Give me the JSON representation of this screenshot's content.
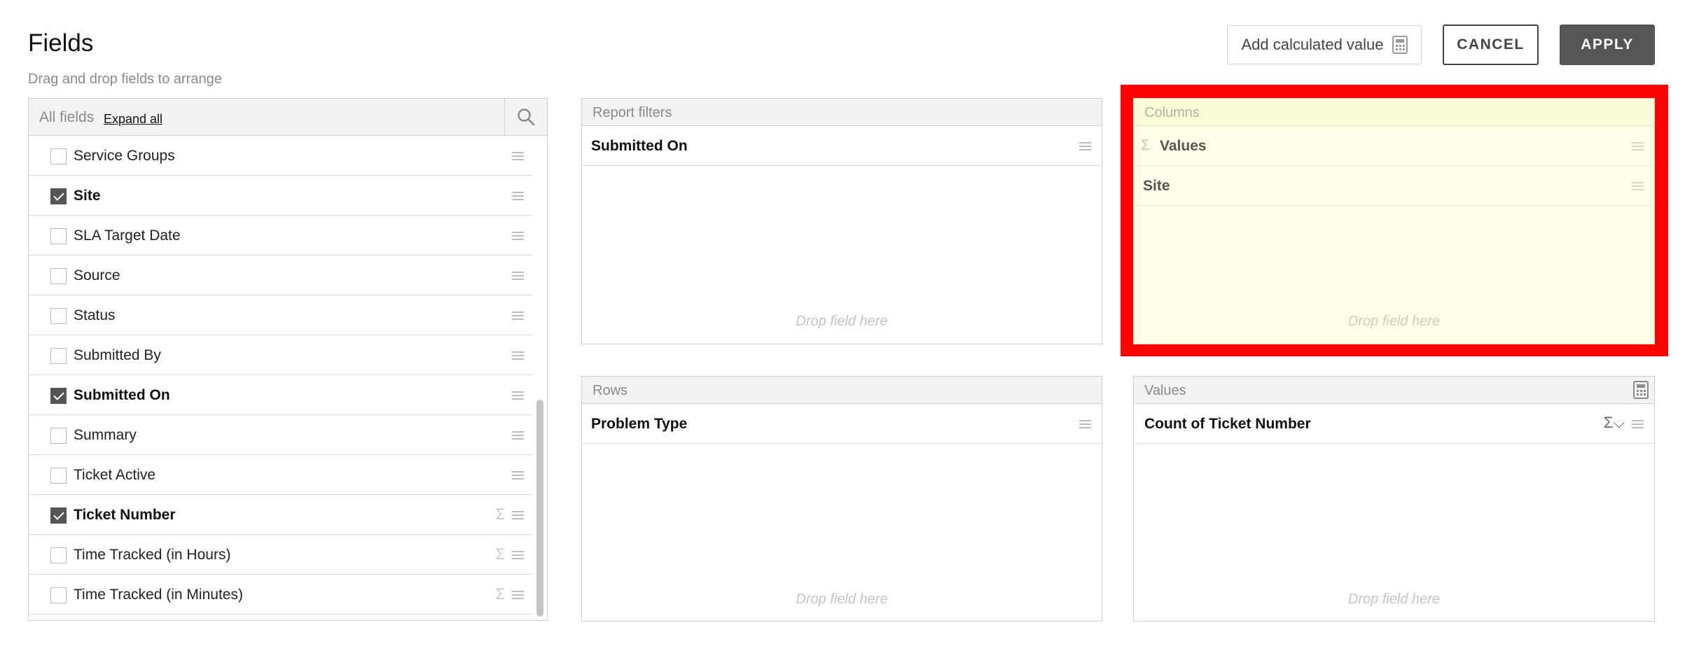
{
  "header": {
    "title": "Fields",
    "subtitle": "Drag and drop fields to arrange",
    "add_calculated_label": "Add calculated value",
    "cancel_label": "CANCEL",
    "apply_label": "APPLY"
  },
  "fields_panel": {
    "header_label": "All fields",
    "expand_all_label": "Expand all",
    "items": [
      {
        "label": "Service Groups",
        "checked": false,
        "numeric": false
      },
      {
        "label": "Site",
        "checked": true,
        "numeric": false
      },
      {
        "label": "SLA Target Date",
        "checked": false,
        "numeric": false
      },
      {
        "label": "Source",
        "checked": false,
        "numeric": false
      },
      {
        "label": "Status",
        "checked": false,
        "numeric": false
      },
      {
        "label": "Submitted By",
        "checked": false,
        "numeric": false
      },
      {
        "label": "Submitted On",
        "checked": true,
        "numeric": false
      },
      {
        "label": "Summary",
        "checked": false,
        "numeric": false
      },
      {
        "label": "Ticket Active",
        "checked": false,
        "numeric": false
      },
      {
        "label": "Ticket Number",
        "checked": true,
        "numeric": true
      },
      {
        "label": "Time Tracked (in Hours)",
        "checked": false,
        "numeric": true
      },
      {
        "label": "Time Tracked (in Minutes)",
        "checked": false,
        "numeric": true
      }
    ]
  },
  "zones": {
    "report_filters": {
      "title": "Report filters",
      "items": [
        "Submitted On"
      ],
      "drop_hint": "Drop field here"
    },
    "columns": {
      "title": "Columns",
      "items": [
        "Values",
        "Site"
      ],
      "drop_hint": "Drop field here"
    },
    "rows": {
      "title": "Rows",
      "items": [
        "Problem Type"
      ],
      "drop_hint": "Drop field here"
    },
    "values": {
      "title": "Values",
      "items": [
        "Count of Ticket Number"
      ],
      "drop_hint": "Drop field here"
    }
  },
  "symbols": {
    "sigma": "Σ",
    "sigma_dropdown": "Σ⌵"
  },
  "colors": {
    "highlight": "#ff0000",
    "apply_bg": "#555555",
    "columns_bg": "#fefde6"
  }
}
